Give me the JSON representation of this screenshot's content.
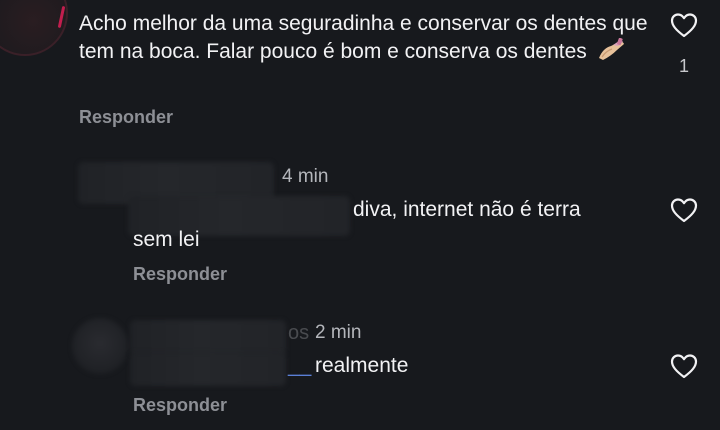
{
  "comment": {
    "text": "Acho melhor da uma seguradinha e conservar os dentes que tem na boca. Falar pouco é bom e conserva os dentes",
    "emoji": "nail-polish-emoji",
    "reply_label": "Responder",
    "likes": "1"
  },
  "replies": [
    {
      "time": "4 min",
      "text": "diva, internet não é terra",
      "text_cont": "sem lei",
      "reply_label": "Responder"
    },
    {
      "time_prefix": "os",
      "time": "2 min",
      "mention": "__",
      "text": "realmente",
      "reply_label": "Responder"
    }
  ],
  "icons": {
    "heart": "heart-outline-icon"
  },
  "colors": {
    "background": "#17191d",
    "text": "#f2f2f4",
    "secondary": "#8d8f95",
    "mention": "#5a7fd6"
  }
}
